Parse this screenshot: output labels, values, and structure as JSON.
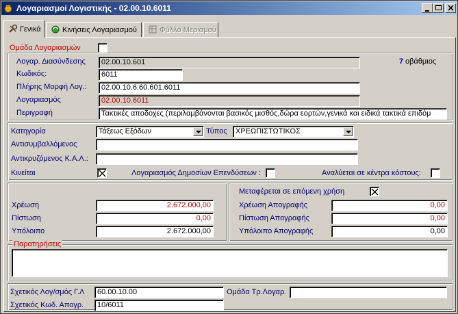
{
  "window": {
    "title": "Λογαριασμοί Λογιστικής - 02.00.10.6011"
  },
  "tabs": [
    {
      "label": "Γενικά"
    },
    {
      "label": "Κινήσεις Λογαριασμού"
    },
    {
      "label": "Φύλλο Μερισμού"
    }
  ],
  "general": {
    "group_accounts_label": "Ομάδα Λογαριασμών",
    "group_accounts_checked": false,
    "link_account_label": "Λογαρ. Διασύνδεσης",
    "link_account_value": "02.00.10.601",
    "level_number": "7",
    "level_text": "οβάθμιος",
    "code_label": "Κωδικός:",
    "code_value": "6011",
    "full_form_label": "Πλήρης Μορφή Λογ.:",
    "full_form_value": "02.00.10.6.60.601.6011",
    "account_label": "Λογαριασμός",
    "account_value": "02.00.10.6011",
    "description_label": "Περιγραφή",
    "description_value": "Τακτικές αποδοχες (περιλαμβάνονται βασικός μισθός,δώρα εορτών,γενικά και ειδικά τακτικά επιδόμ"
  },
  "classification": {
    "category_label": "Κατηγορία",
    "category_value": "Τάξεως Εξόδων",
    "type_label": "Τύπος",
    "type_value": "ΧΡΕΩΠΙΣΤΩΤΙΚΟΣ",
    "counter_label": "Αντισυμβαλλόμενος",
    "counter_value": "",
    "counter_kal_label": "Αντικρυζόμενος Κ.Α.Λ.:",
    "counter_kal_value": "",
    "movable_label": "Κινείται",
    "movable_checked": true,
    "public_invest_label": "Λογαριασμός Δημοσίων Επενδύσεων :",
    "public_invest_checked": false,
    "cost_centers_label": "Αναλύεται σε κέντρα κόστους:",
    "cost_centers_checked": false
  },
  "balances": {
    "debit_label": "Χρέωση",
    "debit_value": "2.672.000,00",
    "credit_label": "Πίστωση",
    "credit_value": "0,00",
    "balance_label": "Υπόλοιπο",
    "balance_value": "2.672.000,00"
  },
  "inventory": {
    "carry_label": "Μεταφέρεται σε επόμενη χρήση",
    "carry_checked": true,
    "debit_label": "Χρέωση Απογραφής",
    "debit_value": "0,00",
    "credit_label": "Πίστωση Απογραφής",
    "credit_value": "0,00",
    "balance_label": "Υπόλοιπο Απογραφής",
    "balance_value": "0,00"
  },
  "remarks": {
    "legend": "Παρατηρήσεις",
    "value": ""
  },
  "related": {
    "gl_label": "Σχετικός Λογ/σμός Γ.Λ",
    "gl_value": "60.00.10.00",
    "tr_group_label": "Ομάδα Τρ.Λογαρ.",
    "tr_group_value": "",
    "inv_code_label": "Σχετικός Κωδ. Απογρ.",
    "inv_code_value": "10/6011"
  },
  "colors": {
    "titlebar_start": "#0a246a",
    "titlebar_end": "#a6caf0",
    "label_blue": "#00006e",
    "label_red": "#c00000"
  }
}
